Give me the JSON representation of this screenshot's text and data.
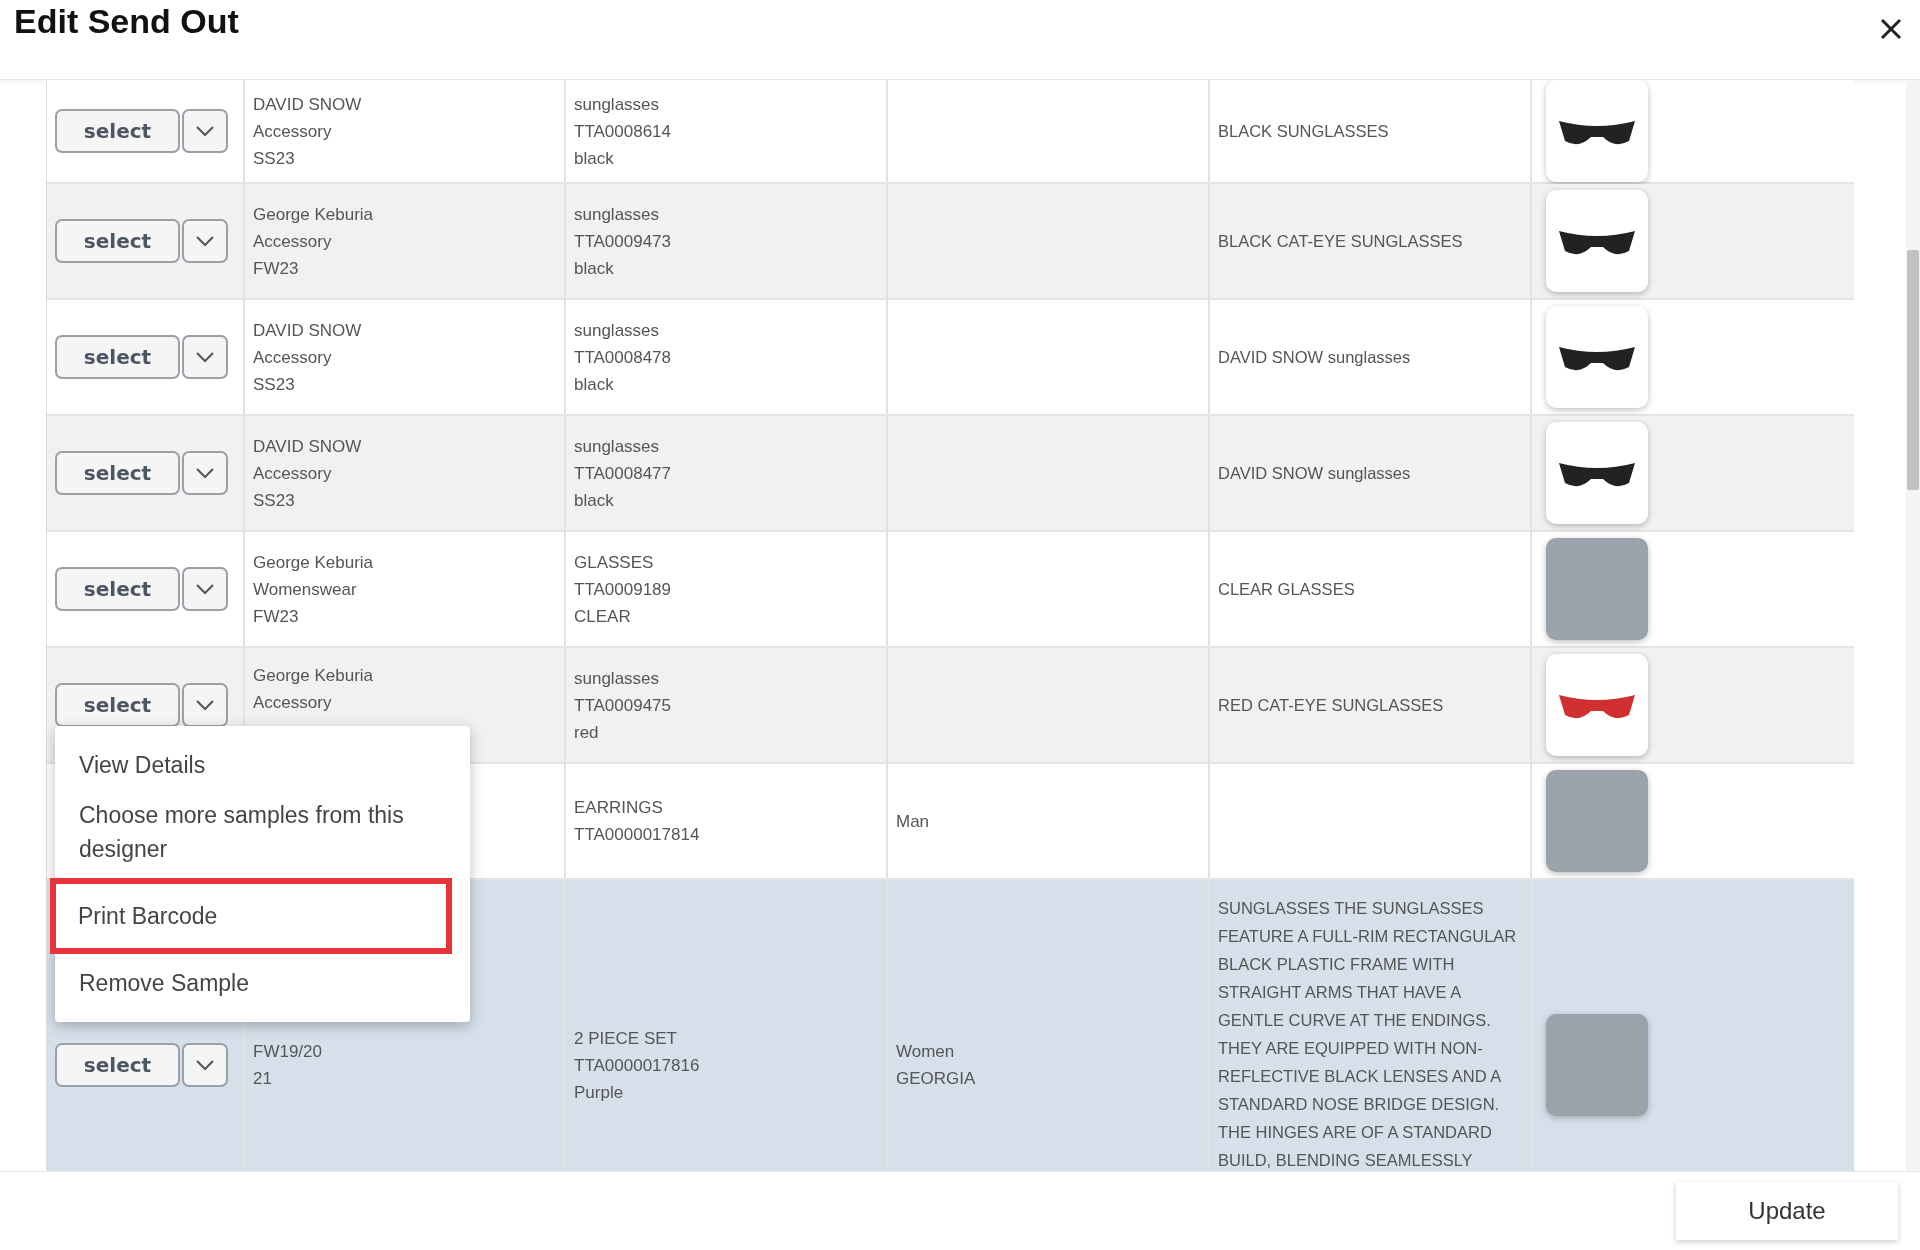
{
  "dialog": {
    "title": "Edit Send Out"
  },
  "rows": [
    {
      "action": "select",
      "designer": [
        "DAVID SNOW",
        "Accessory",
        "SS23"
      ],
      "item": [
        "sunglasses",
        "TTA0008614",
        "black"
      ],
      "column_4": [],
      "description": "BLACK SUNGLASSES",
      "image": {
        "kind": "sunglasses",
        "color": "#222222"
      },
      "highlighted": false
    },
    {
      "action": "select",
      "designer": [
        "George Keburia",
        "Accessory",
        "FW23"
      ],
      "item": [
        "sunglasses",
        "TTA0009473",
        "black"
      ],
      "column_4": [],
      "description": "BLACK CAT-EYE SUNGLASSES",
      "image": {
        "kind": "sunglasses",
        "color": "#222222"
      },
      "highlighted": false
    },
    {
      "action": "select",
      "designer": [
        "DAVID SNOW",
        "Accessory",
        "SS23"
      ],
      "item": [
        "sunglasses",
        "TTA0008478",
        "black"
      ],
      "column_4": [],
      "description": "DAVID SNOW sunglasses",
      "image": {
        "kind": "sunglasses",
        "color": "#222222"
      },
      "highlighted": false
    },
    {
      "action": "select",
      "designer": [
        "DAVID SNOW",
        "Accessory",
        "SS23"
      ],
      "item": [
        "sunglasses",
        "TTA0008477",
        "black"
      ],
      "column_4": [],
      "description": "DAVID SNOW sunglasses",
      "image": {
        "kind": "sunglasses",
        "color": "#222222"
      },
      "highlighted": false
    },
    {
      "action": "select",
      "designer": [
        "George Keburia",
        "Womenswear",
        "FW23"
      ],
      "item": [
        "GLASSES",
        "TTA0009189",
        "CLEAR"
      ],
      "column_4": [],
      "description": "CLEAR GLASSES",
      "image": {
        "kind": "photo"
      },
      "highlighted": false
    },
    {
      "action": "select",
      "designer": [
        "George Keburia",
        "Accessory"
      ],
      "item": [
        "sunglasses",
        "TTA0009475",
        "red"
      ],
      "column_4": [],
      "description": "RED CAT-EYE SUNGLASSES",
      "image": {
        "kind": "sunglasses",
        "color": "#d03030"
      },
      "highlighted": false,
      "menu": {
        "items": [
          {
            "label": "View Details",
            "marked": false
          },
          {
            "label": "Choose more samples from this designer",
            "marked": false
          },
          {
            "label": "Print Barcode",
            "marked": true
          },
          {
            "label": "Remove Sample",
            "marked": false
          }
        ]
      }
    },
    {
      "designer": [],
      "item": [
        "EARRINGS",
        "TTA0000017814"
      ],
      "column_4": [
        "Man"
      ],
      "description": "",
      "image": {
        "kind": "photo"
      },
      "highlighted": false
    },
    {
      "action": "select",
      "designer": [
        "FW19/20",
        "21"
      ],
      "item": [
        "2 PIECE SET",
        "TTA0000017816",
        "Purple"
      ],
      "column_4": [
        "Women",
        "GEORGIA"
      ],
      "description": "SUNGLASSES THE SUNGLASSES FEATURE A FULL-RIM RECTANGULAR BLACK PLASTIC FRAME WITH STRAIGHT ARMS THAT HAVE A GENTLE CURVE AT THE ENDINGS. THEY ARE EQUIPPED WITH NON-REFLECTIVE BLACK LENSES AND A STANDARD NOSE BRIDGE DESIGN. THE HINGES ARE OF A STANDARD BUILD, BLENDING SEAMLESSLY",
      "image": {
        "kind": "photo"
      },
      "highlighted": true
    }
  ],
  "footer": {
    "button": "Update"
  }
}
